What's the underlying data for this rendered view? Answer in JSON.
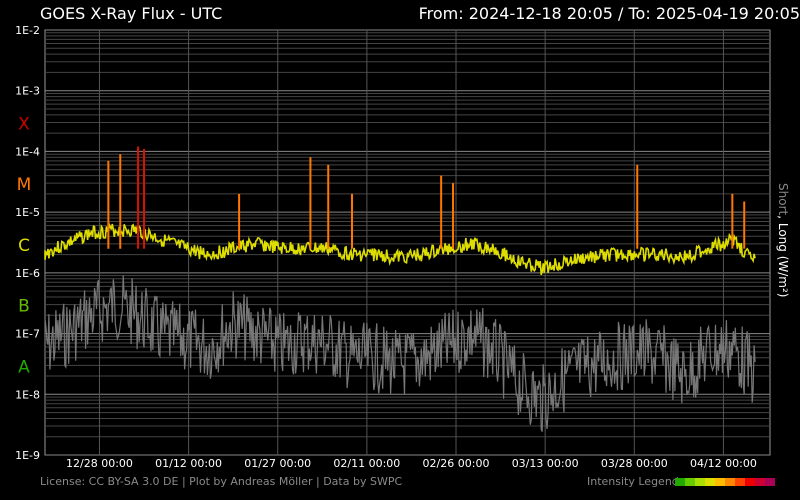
{
  "header": {
    "title": "GOES X-Ray Flux - UTC",
    "range_from": "From: 2024-12-18 20:05",
    "separator": "/",
    "range_to": "To: 2025-04-19 20:05"
  },
  "side_label": {
    "short": "Short",
    "comma": ", ",
    "long": "Long (W/m²)"
  },
  "footer": {
    "credits": "License: CC BY-SA 3.0 DE | Plot by Andreas Möller | Data by SWPC",
    "legend_label": "Intensity Legend"
  },
  "legend_colors": [
    "#22aa00",
    "#66cc00",
    "#aadd00",
    "#dddd00",
    "#ffbb00",
    "#ff8800",
    "#ff4400",
    "#ee0000",
    "#cc0033",
    "#aa0055"
  ],
  "chart_data": {
    "type": "line",
    "title": "GOES X-Ray Flux - UTC",
    "ylabel": "Long (W/m²)",
    "yscale": "log",
    "ylim": [
      1e-09,
      0.01
    ],
    "y_ticks": [
      "1E-2",
      "1E-3",
      "1E-4",
      "1E-5",
      "1E-6",
      "1E-7",
      "1E-8",
      "1E-9"
    ],
    "flare_classes": [
      {
        "label": "X",
        "color": "#cc0000",
        "level": 0.0003
      },
      {
        "label": "M",
        "color": "#ff7700",
        "level": 3e-05
      },
      {
        "label": "C",
        "color": "#dddd00",
        "level": 3e-06
      },
      {
        "label": "B",
        "color": "#66bb00",
        "level": 3e-07
      },
      {
        "label": "A",
        "color": "#22aa00",
        "level": 3e-08
      }
    ],
    "xlim": [
      "2024-12-18 20:05",
      "2025-04-19 20:05"
    ],
    "x_ticks": [
      "12/28 00:00",
      "01/12 00:00",
      "01/27 00:00",
      "02/11 00:00",
      "02/26 00:00",
      "03/13 00:00",
      "03/28 00:00",
      "04/12 00:00"
    ],
    "grid": true,
    "series": [
      {
        "name": "Long",
        "color": "#dddd00",
        "x": [
          "2024-12-18",
          "2024-12-22",
          "2024-12-26",
          "2024-12-30",
          "2025-01-03",
          "2025-01-07",
          "2025-01-11",
          "2025-01-15",
          "2025-01-19",
          "2025-01-23",
          "2025-01-27",
          "2025-01-31",
          "2025-02-04",
          "2025-02-08",
          "2025-02-12",
          "2025-02-16",
          "2025-02-20",
          "2025-02-24",
          "2025-02-28",
          "2025-03-04",
          "2025-03-08",
          "2025-03-12",
          "2025-03-16",
          "2025-03-20",
          "2025-03-24",
          "2025-03-28",
          "2025-04-01",
          "2025-04-05",
          "2025-04-09",
          "2025-04-13",
          "2025-04-17"
        ],
        "values": [
          2e-06,
          3e-06,
          4.5e-06,
          5e-06,
          5e-06,
          3.5e-06,
          2.5e-06,
          2e-06,
          2.5e-06,
          3e-06,
          2.5e-06,
          2.5e-06,
          2.5e-06,
          2e-06,
          2e-06,
          1.8e-06,
          2e-06,
          2.5e-06,
          3e-06,
          2.5e-06,
          1.5e-06,
          1.2e-06,
          1.5e-06,
          1.8e-06,
          2e-06,
          2e-06,
          2e-06,
          1.8e-06,
          2.5e-06,
          3.5e-06,
          1.5e-06
        ]
      },
      {
        "name": "Short",
        "color": "#777777",
        "x": [
          "2024-12-18",
          "2024-12-22",
          "2024-12-26",
          "2024-12-30",
          "2025-01-03",
          "2025-01-07",
          "2025-01-11",
          "2025-01-15",
          "2025-01-19",
          "2025-01-23",
          "2025-01-27",
          "2025-01-31",
          "2025-02-04",
          "2025-02-08",
          "2025-02-12",
          "2025-02-16",
          "2025-02-20",
          "2025-02-24",
          "2025-02-28",
          "2025-03-04",
          "2025-03-08",
          "2025-03-12",
          "2025-03-16",
          "2025-03-20",
          "2025-03-24",
          "2025-03-28",
          "2025-04-01",
          "2025-04-05",
          "2025-04-09",
          "2025-04-13",
          "2025-04-17"
        ],
        "values": [
          6e-08,
          1e-07,
          2e-07,
          3e-07,
          2e-07,
          1e-07,
          8e-08,
          6e-08,
          1.5e-07,
          1e-07,
          6e-08,
          8e-08,
          7e-08,
          4e-08,
          4e-08,
          3e-08,
          4e-08,
          6e-08,
          1e-07,
          5e-08,
          1.5e-08,
          8e-09,
          2e-08,
          3e-08,
          4e-08,
          5e-08,
          4e-08,
          2e-08,
          5e-08,
          6e-08,
          2e-08
        ]
      }
    ],
    "peaks": [
      {
        "x": "2024-12-29",
        "value": 7e-05
      },
      {
        "x": "2024-12-31",
        "value": 9e-05
      },
      {
        "x": "2025-01-03",
        "value": 0.00012
      },
      {
        "x": "2025-01-04",
        "value": 0.00011
      },
      {
        "x": "2025-01-20",
        "value": 2e-05
      },
      {
        "x": "2025-02-01",
        "value": 8e-05
      },
      {
        "x": "2025-02-04",
        "value": 6e-05
      },
      {
        "x": "2025-02-08",
        "value": 2e-05
      },
      {
        "x": "2025-02-23",
        "value": 4e-05
      },
      {
        "x": "2025-02-25",
        "value": 3e-05
      },
      {
        "x": "2025-03-28",
        "value": 6e-05
      },
      {
        "x": "2025-04-13",
        "value": 2e-05
      },
      {
        "x": "2025-04-15",
        "value": 1.5e-05
      }
    ]
  }
}
